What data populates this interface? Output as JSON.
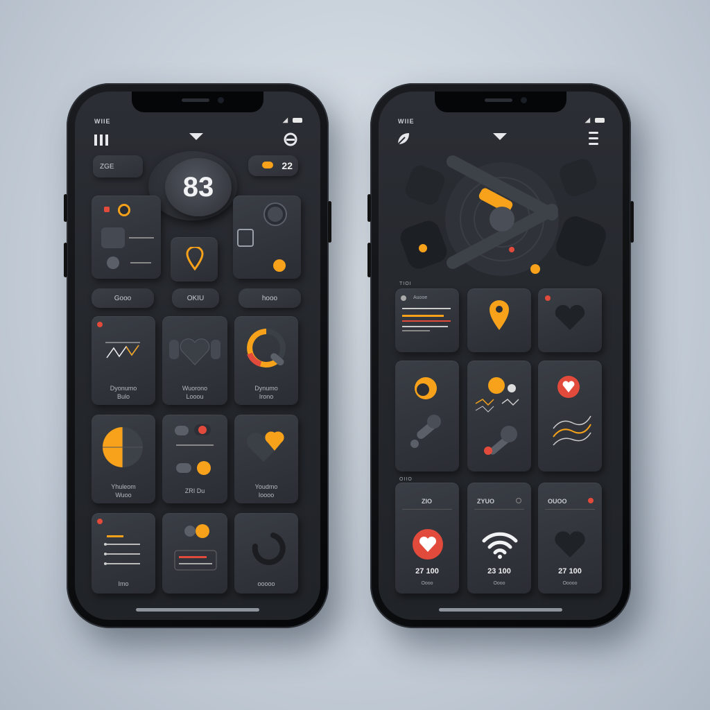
{
  "colors": {
    "accent": "#f7a21a",
    "alert": "#e24a3b",
    "screen": "#26292e",
    "card": "#33373d"
  },
  "left_phone": {
    "status": "WIIE",
    "header": {
      "menu_icon": "bars-icon",
      "dropdown_icon": "chevron-down-icon",
      "profile_icon": "circle-icon"
    },
    "pill_left": "ZGE",
    "center_value": "83",
    "top_right": "22",
    "pills": [
      "Gooo",
      "OKIU",
      "hooo"
    ],
    "cards": [
      {
        "icon": "line-chart-icon",
        "caption": [
          "Dyonumo",
          "Bulo"
        ]
      },
      {
        "icon": "heart-icon",
        "caption": [
          "Wuorono",
          "Looou"
        ]
      },
      {
        "icon": "progress-ring-icon",
        "caption": [
          "Dynumo",
          "Irono"
        ]
      },
      {
        "icon": "globe-icon",
        "caption": [
          "Yhuleom",
          "Wuoo"
        ]
      },
      {
        "icon": "toggle-icon",
        "caption": [
          "ZRI Du"
        ]
      },
      {
        "icon": "heart-pin-icon",
        "caption": [
          "Youdmo",
          "Ioooo"
        ]
      },
      {
        "icon": "list-icon",
        "caption": [
          "Imo"
        ]
      },
      {
        "icon": "slider-icon",
        "caption": [
          ""
        ]
      },
      {
        "icon": "arc-icon",
        "caption": [
          "ooooo"
        ]
      }
    ]
  },
  "right_phone": {
    "status": "WIIE",
    "header": {
      "logo_icon": "leaf-icon",
      "dropdown_icon": "chevron-down-icon",
      "settings_icon": "sliders-icon"
    },
    "section_label": "TIOI",
    "row1": [
      {
        "icon": "bar-list-icon",
        "title": "Auooe"
      },
      {
        "icon": "location-pin-icon"
      },
      {
        "icon": "heart-icon"
      }
    ],
    "row2": [
      {
        "icon": "knob-icon"
      },
      {
        "icon": "joystick-icon"
      },
      {
        "icon": "heart-wave-icon"
      }
    ],
    "row3_label": "OIIO",
    "row3": [
      {
        "label": "ZIO",
        "value": "27 100",
        "foot": "Oooo",
        "icon": "heart-badge-icon"
      },
      {
        "label": "ZYUO",
        "value": "23 100",
        "foot": "Oooo",
        "icon": "wifi-icon"
      },
      {
        "label": "OUOO",
        "value": "27 100",
        "foot": "Ooooo",
        "icon": "heart-icon"
      }
    ]
  }
}
